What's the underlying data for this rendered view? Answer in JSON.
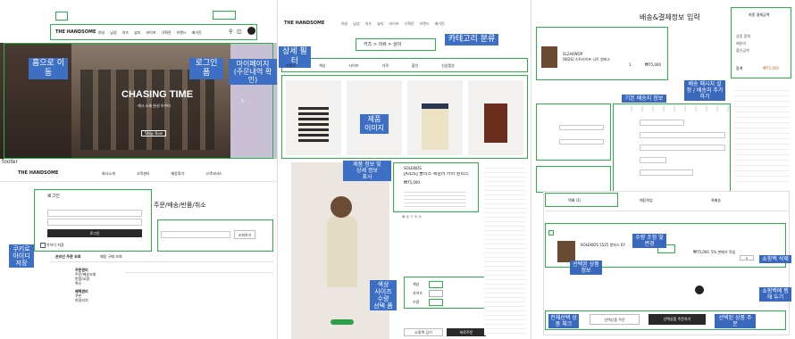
{
  "panel1": {
    "brand": "THE HANDSOME",
    "nav": [
      "여성",
      "남성",
      "키즈",
      "뷰티",
      "라이프",
      "기획전",
      "브랜드",
      "매거진",
      "이벤트",
      "아울렛"
    ],
    "hero_title": "CHASING TIME",
    "hero_sub": "캐시·소재 완성 아우터",
    "hero_btn": "Shop Now",
    "footer_tag": "footer",
    "footer_brand": "THE HANDSOME",
    "footer_links": [
      "회사소개",
      "고객센터",
      "매장찾기",
      "고객서비스"
    ],
    "login_title": "로그인",
    "login_id_placeholder": "아이디 또는 이메일을 입력해 주세요",
    "login_pw_placeholder": "비밀번호를 입력해 주세요",
    "login_btn": "로그인",
    "login_remember": "아이디 저장",
    "order_tabs": "주문/배송/반품/취소",
    "order_search_btn": "조회하기",
    "order_subtabs": [
      "온라인 주문 조회",
      "매장 구매 조회"
    ],
    "mypage_menu": [
      "주문관리",
      "주문/배송조회",
      "반품/교환",
      "취소",
      "혜택관리",
      "쿠폰",
      "마일리지"
    ],
    "callouts": {
      "home": "홈으로 이동",
      "login": "로그인 폼",
      "mypage": "마이페이지\n(주문내역 확인)",
      "cookie": "쿠키로\n아이디\n저장"
    }
  },
  "panel2": {
    "brand": "THE HANDSOME",
    "breadcrumb": [
      "키즈",
      "의류",
      "상의"
    ],
    "filters": [
      "브랜드",
      "색상",
      "사이즈",
      "가격",
      "할인"
    ],
    "sort": "신상품순",
    "product_name": "[KIDS] 플리스 세일러 카라 원피스",
    "product_brand": "SOLEKIDS",
    "price": "₩75,000",
    "options": [
      "색상",
      "사이즈",
      "수량"
    ],
    "cart_btn": "쇼핑백 담기",
    "buy_btn": "바로주문",
    "callouts": {
      "filter": "상세 필터",
      "category": "카테고리 분류",
      "image": "제품\n이미지",
      "info": "제품 정보 및\n상세 정보\n표시",
      "option": "색상\n사이즈\n수량\n선택 폼"
    }
  },
  "panel3": {
    "title": "배송&결제정보 입력",
    "summary_title": "최종 결제금액",
    "summary_rows": [
      "상품 합계",
      "배송비",
      "할인금액"
    ],
    "summary_total_label": "합계",
    "summary_total": "₩75,000",
    "item_code": "SL2A4WOP",
    "item_name": "[KIDS] 스트라이프 니트 원피스",
    "item_qty": "1",
    "item_price": "₩75,000",
    "cart_tabs": [
      "택배 (1)",
      "매장픽업",
      "퀵배송"
    ],
    "cart_cols": [
      "상품정보",
      "수량",
      "판매가",
      "적립금",
      "선택"
    ],
    "cart_item_name": "SOLEKIDS 5525 원피스 6Y",
    "cart_item_price": "₩75,000",
    "cart_item_points": "5% 판매가 적립",
    "order_selected_btn": "선택상품 주문",
    "order_all_btn": "선택상품 주문하기",
    "callouts": {
      "delivery_info": "기본 배송지 정보",
      "apply_coupon": "배송 메시지 설정 / 배송지 추가하기",
      "selected_info": "선택된 상품 정보",
      "qty_change": "수량 조정 및 변경",
      "delete": "쇼핑백 삭제",
      "wish": "쇼핑백에 찜해 두기",
      "select_all": "전체선택 상품 체크",
      "order_selected": "선택된 상품 주문"
    }
  }
}
